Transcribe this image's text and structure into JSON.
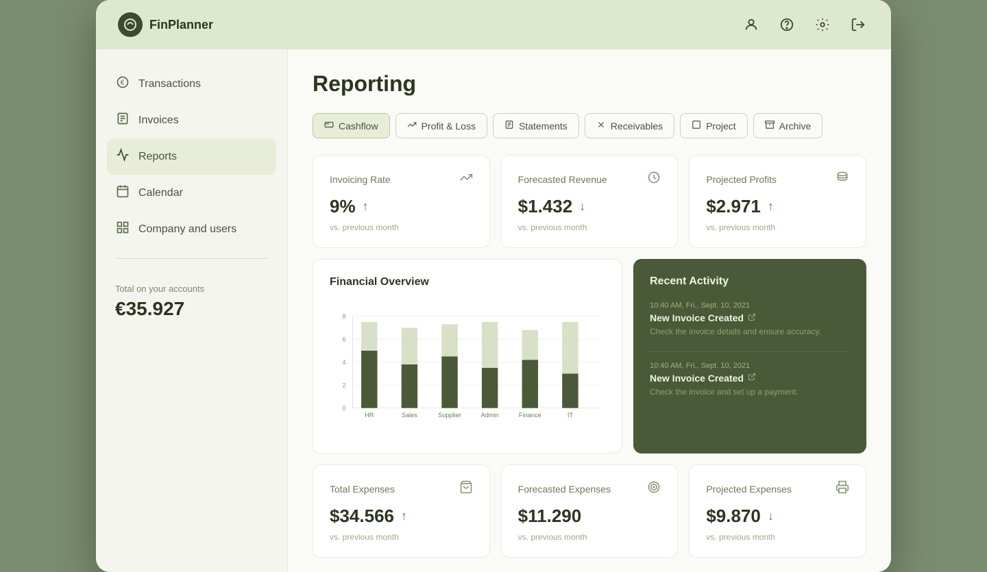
{
  "app": {
    "name": "FinPlanner"
  },
  "header": {
    "icons": [
      "user-icon",
      "help-icon",
      "settings-icon",
      "logout-icon"
    ]
  },
  "sidebar": {
    "nav_items": [
      {
        "id": "transactions",
        "label": "Transactions",
        "icon": "€"
      },
      {
        "id": "invoices",
        "label": "Invoices",
        "icon": "invoice"
      },
      {
        "id": "reports",
        "label": "Reports",
        "icon": "chart"
      },
      {
        "id": "calendar",
        "label": "Calendar",
        "icon": "calendar"
      },
      {
        "id": "company",
        "label": "Company and users",
        "icon": "grid"
      }
    ],
    "active_item": "reports",
    "account_label": "Total on your accounts",
    "account_value": "€35.927"
  },
  "content": {
    "page_title": "Reporting",
    "tabs": [
      {
        "id": "cashflow",
        "label": "Cashflow",
        "active": true
      },
      {
        "id": "profit-loss",
        "label": "Profit & Loss",
        "active": false
      },
      {
        "id": "statements",
        "label": "Statements",
        "active": false
      },
      {
        "id": "receivables",
        "label": "Receivables",
        "active": false
      },
      {
        "id": "project",
        "label": "Project",
        "active": false
      },
      {
        "id": "archive",
        "label": "Archive",
        "active": false
      }
    ],
    "stats_top": [
      {
        "id": "invoicing-rate",
        "label": "Invoicing Rate",
        "value": "9%",
        "arrow": "up",
        "compare": "vs. previous month",
        "icon": "trending-up"
      },
      {
        "id": "forecasted-revenue",
        "label": "Forecasted Revenue",
        "value": "$1.432",
        "arrow": "down",
        "compare": "vs. previous month",
        "icon": "clock"
      },
      {
        "id": "projected-profits",
        "label": "Projected Profits",
        "value": "$2.971",
        "arrow": "up",
        "compare": "vs. previous month",
        "icon": "coins"
      }
    ],
    "chart": {
      "title": "Financial Overview",
      "categories": [
        "HR",
        "Sales",
        "Supplier",
        "Admin",
        "Finance",
        "IT"
      ],
      "bars": [
        {
          "label": "HR",
          "dark": 5.0,
          "light": 2.5
        },
        {
          "label": "Sales",
          "dark": 3.8,
          "light": 3.2
        },
        {
          "label": "Supplier",
          "dark": 4.5,
          "light": 2.8
        },
        {
          "label": "Admin",
          "dark": 3.5,
          "light": 4.0
        },
        {
          "label": "Finance",
          "dark": 4.2,
          "light": 2.6
        },
        {
          "label": "IT",
          "dark": 3.0,
          "light": 4.5
        }
      ],
      "y_labels": [
        "0",
        "2",
        "4",
        "6",
        "8"
      ]
    },
    "recent_activity": {
      "title": "Recent Activity",
      "items": [
        {
          "time": "10:40 AM, Fri., Sept. 10, 2021",
          "event": "New Invoice Created",
          "desc": "Check the invoice details and ensure accuracy."
        },
        {
          "time": "10:40 AM, Fri., Sept. 10, 2021",
          "event": "New Invoice Created",
          "desc": "Check the invoice and set up a payment."
        }
      ]
    },
    "stats_bottom": [
      {
        "id": "total-expenses",
        "label": "Total Expenses",
        "value": "$34.566",
        "arrow": "up",
        "compare": "vs. previous month",
        "icon": "bag"
      },
      {
        "id": "forecasted-expenses",
        "label": "Forecasted Expenses",
        "value": "$11.290",
        "arrow": "none",
        "compare": "vs. previous month",
        "icon": "target"
      },
      {
        "id": "projected-expenses",
        "label": "Projected Expenses",
        "value": "$9.870",
        "arrow": "down",
        "compare": "vs. previous month",
        "icon": "printer"
      }
    ]
  }
}
